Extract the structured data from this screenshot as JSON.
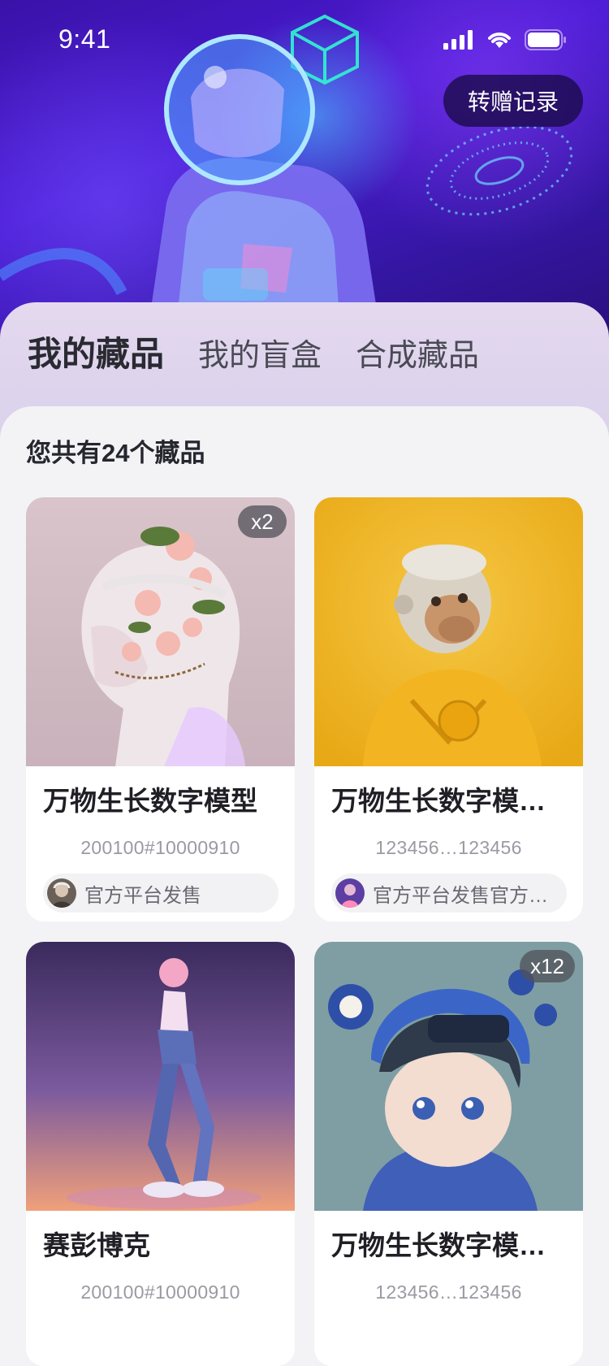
{
  "status_bar": {
    "time": "9:41"
  },
  "header": {
    "transfer_label": "转赠记录"
  },
  "tabs": [
    {
      "label": "我的藏品",
      "active": true
    },
    {
      "label": "我的盲盒",
      "active": false
    },
    {
      "label": "合成藏品",
      "active": false
    }
  ],
  "summary": {
    "total_text": "您共有24个藏品"
  },
  "collectibles": [
    {
      "title": "万物生长数字模型",
      "serial": "200100#10000910",
      "issuer": "官方平台发售",
      "count_badge": "x2",
      "image": "floral-portrait"
    },
    {
      "title": "万物生长数字模型…",
      "serial": "123456…123456",
      "issuer": "官方平台发售官方…",
      "count_badge": "",
      "image": "ape-yellow-jacket"
    },
    {
      "title": "赛彭博克",
      "serial": "200100#10000910",
      "issuer": "",
      "count_badge": "",
      "image": "walking-figure"
    },
    {
      "title": "万物生长数字模型…",
      "serial": "123456…123456",
      "issuer": "",
      "count_badge": "x12",
      "image": "chibi-girl"
    }
  ],
  "colors": {
    "hero": "#3a12a8",
    "tab_panel": "#e0d6ee",
    "content_bg": "#f3f3f6",
    "card_bg": "#ffffff"
  }
}
